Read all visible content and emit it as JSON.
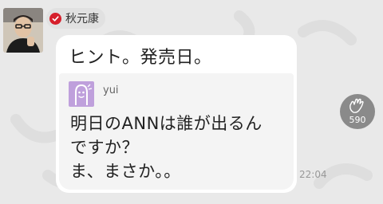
{
  "message": {
    "sender_name": "秋元康",
    "text": "ヒント。発売日。",
    "time": "22:04"
  },
  "reply": {
    "username": "yui",
    "text": "明日のANNは誰が出るん\nですか？\nま、まさか。。"
  },
  "reaction": {
    "icon": "clap-icon",
    "count": "590"
  },
  "colors": {
    "background": "#e9e9e9",
    "bubble": "#ffffff",
    "quote_bg": "#f4f4f4",
    "verified_badge": "#d61f2b",
    "reply_avatar": "#bfa0dc",
    "reaction_bg": "#8a8a8a"
  }
}
